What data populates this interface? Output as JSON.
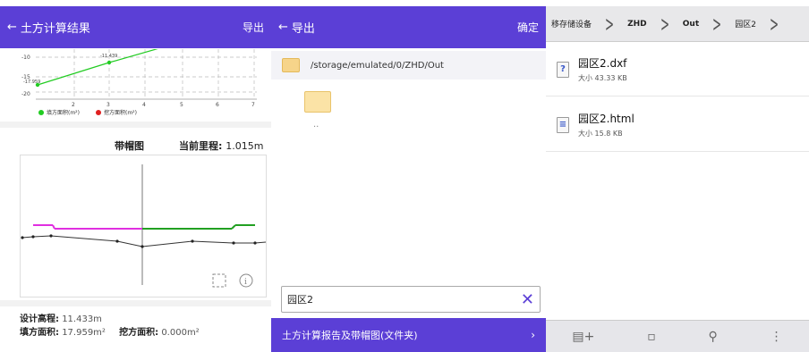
{
  "panel1": {
    "title": "土方计算结果",
    "back_icon": "arrow-left-icon",
    "export": "导出",
    "chart_data": {
      "type": "line",
      "x": [
        1,
        2,
        3,
        4,
        5,
        6,
        7
      ],
      "y_ticks": [
        "-10",
        "-15",
        "-20"
      ],
      "x_ticks": [
        "2",
        "3",
        "4",
        "5",
        "6",
        "7"
      ],
      "series": [
        {
          "name": "填方面积(m²)",
          "color": "#22cc22",
          "points": [
            [
              1,
              -17.959
            ],
            [
              3,
              -11.439
            ]
          ]
        },
        {
          "name": "挖方面积(m²)",
          "color": "#e02020",
          "points": []
        }
      ],
      "labels": [
        "-11.439",
        "-17.959"
      ]
    },
    "band_label": "带帽图",
    "mileage_label": "当前里程:",
    "mileage_value": "1.015m",
    "design_label": "设计高程:",
    "design_value": "11.433m",
    "fill_label": "填方面积:",
    "fill_value": "17.959m²",
    "cut_label": "挖方面积:",
    "cut_value": "0.000m²"
  },
  "panel2": {
    "title": "导出",
    "confirm": "确定",
    "path": "/storage/emulated/0/ZHD/Out",
    "dots": "..",
    "filename": "园区2",
    "option": "土方计算报告及带帽图(文件夹)"
  },
  "panel3": {
    "crumbs": [
      "移存储设备",
      "ZHD",
      "Out",
      "园区2"
    ],
    "files": [
      {
        "name": "园区2.dxf",
        "size": "大小 43.33 KB",
        "icon": "question-file-icon"
      },
      {
        "name": "园区2.html",
        "size": "大小 15.8 KB",
        "icon": "html-file-icon"
      }
    ],
    "toolbar_icons": [
      "new-folder-icon",
      "clipboard-icon",
      "search-icon",
      "more-vert-icon"
    ]
  },
  "colors": {
    "accent": "#5b3fd6",
    "fill": "#22cc22",
    "cut": "#e02020",
    "design": "#e02fe0"
  }
}
